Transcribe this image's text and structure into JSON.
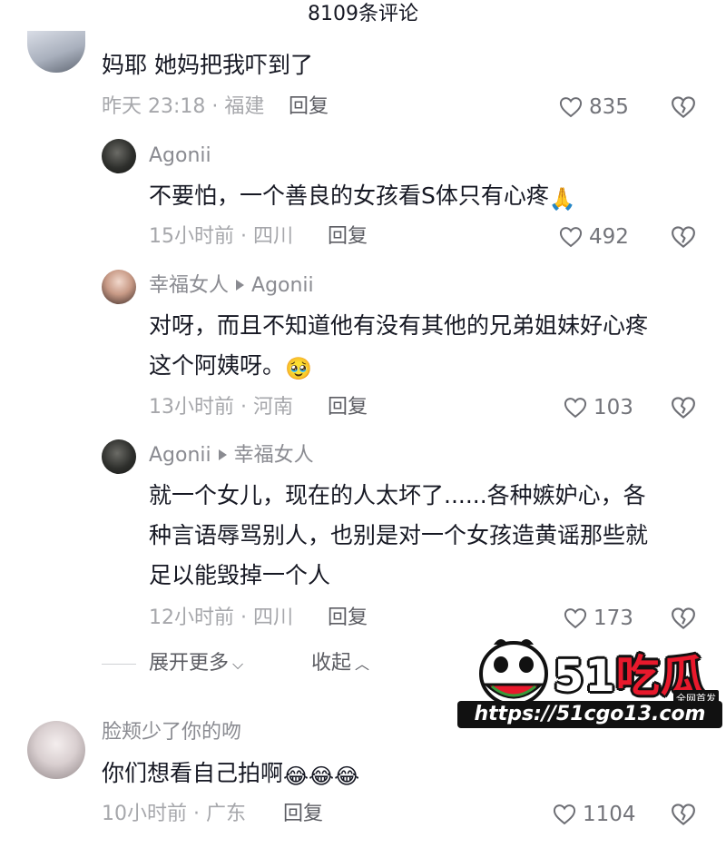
{
  "header": {
    "title": "8109条评论"
  },
  "comments": [
    {
      "text": "妈耶 她妈把我吓到了",
      "meta": "昨天 23:18 · 福建",
      "reply": "回复",
      "likes": "835"
    },
    {
      "author": "Agonii",
      "text": "不要怕，一个善良的女孩看S体只有心疼",
      "emoji": "🙏",
      "meta": "15小时前 · 四川",
      "reply": "回复",
      "likes": "492"
    },
    {
      "author": "幸福女人",
      "reply_to": "Agonii",
      "text_line1": "对呀，而且不知道他有没有其他的兄弟姐妹好心疼",
      "text_line2": "这个阿姨呀。",
      "emoji": "🥹",
      "meta": "13小时前 · 河南",
      "reply": "回复",
      "likes": "103"
    },
    {
      "author": "Agonii",
      "reply_to": "幸福女人",
      "text_line1": "就一个女儿，现在的人太坏了......各种嫉妒心，各",
      "text_line2": "种言语辱骂别人，也别是对一个女孩造黄谣那些就",
      "text_line3": "足以能毁掉一个人",
      "meta": "12小时前 · 四川",
      "reply": "回复",
      "likes": "173"
    },
    {
      "author": "脸颊少了你的吻",
      "text": "你们想看自己拍啊",
      "emoji": "😂😂😂",
      "meta": "10小时前 · 广东",
      "reply": "回复",
      "likes": "1104"
    }
  ],
  "thread_controls": {
    "expand": "展开更多",
    "collapse": "收起"
  },
  "watermark": {
    "logo_num": "51",
    "logo_text": "吃瓜",
    "badge": "全网首发",
    "url": "https://51cgo13.com"
  },
  "icons": {
    "like": "heart-outline-icon",
    "dislike": "broken-heart-icon",
    "expand": "chevron-down-icon",
    "collapse": "chevron-up-icon"
  },
  "colors": {
    "text": "#161823",
    "meta": "#a6a7ab",
    "accent_red": "#e8192c"
  }
}
